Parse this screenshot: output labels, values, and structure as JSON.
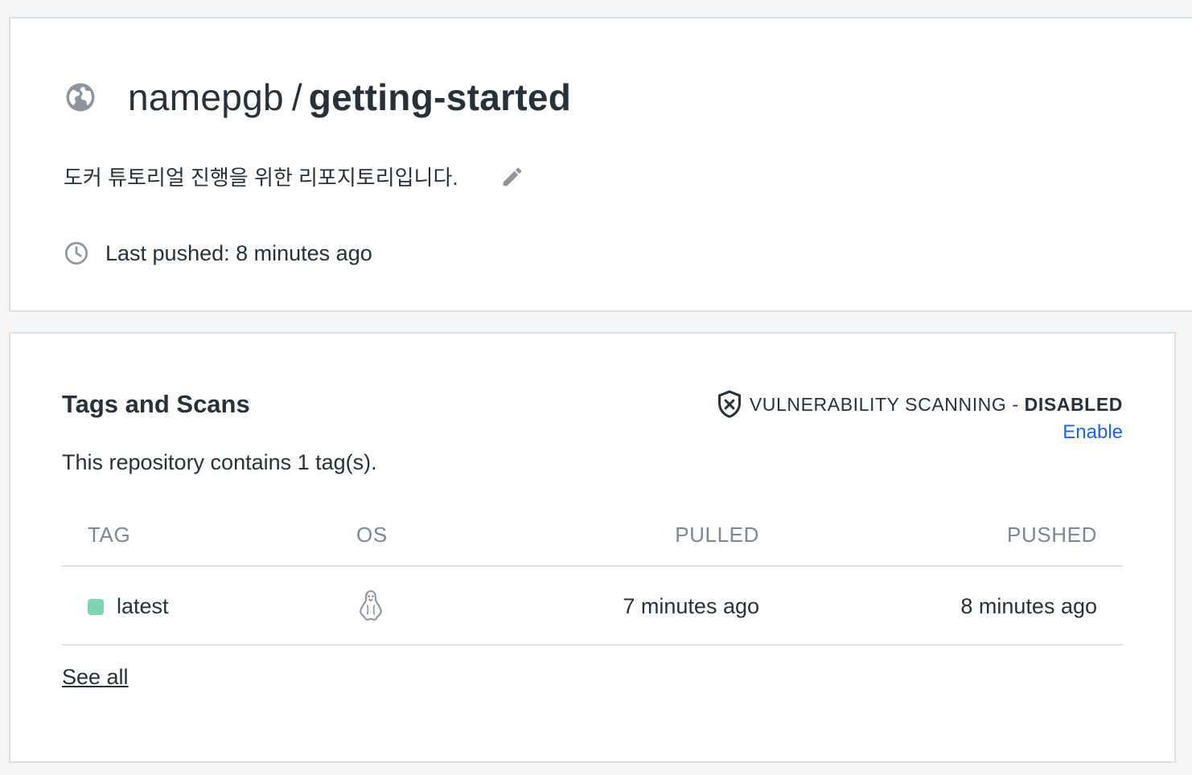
{
  "repo": {
    "namespace": "namepgb",
    "separator": "/",
    "name": "getting-started",
    "visibility_icon": "globe-icon",
    "description": "도커 튜토리얼 진행을 위한 리포지토리입니다.",
    "edit_icon": "pencil-icon",
    "last_pushed": "Last pushed: 8 minutes ago"
  },
  "tags": {
    "title": "Tags and Scans",
    "count_text": "This repository contains 1 tag(s).",
    "vuln_label": "VULNERABILITY SCANNING - ",
    "vuln_status": "DISABLED",
    "enable_label": "Enable",
    "columns": [
      "TAG",
      "OS",
      "PULLED",
      "PUSHED"
    ],
    "rows": [
      {
        "tag": "latest",
        "os_icon": "linux-icon",
        "pulled": "7 minutes ago",
        "pushed": "8 minutes ago",
        "status_color": "#7fd4b4"
      }
    ],
    "see_all_label": "See all"
  },
  "colors": {
    "accent_link": "#1d63ed",
    "text": "#27313a",
    "muted": "#7d8792",
    "border": "#dcdfe3"
  }
}
